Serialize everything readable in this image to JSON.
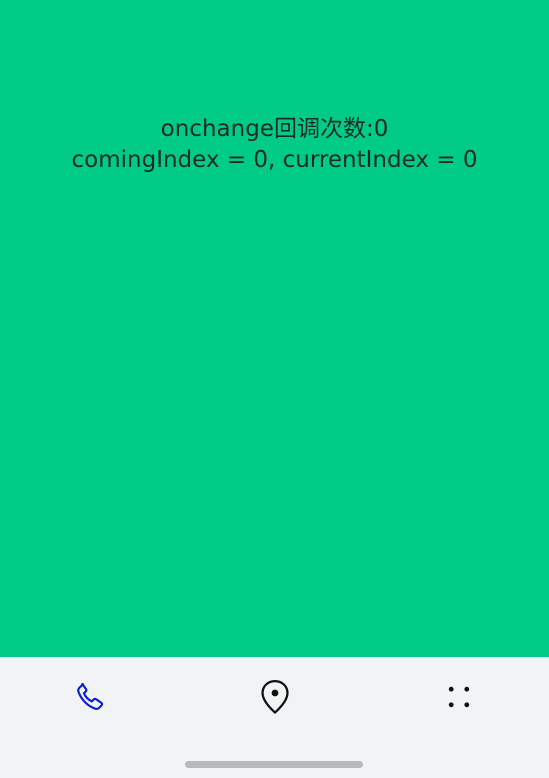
{
  "content": {
    "callback_count_line": "onchange回调次数:0",
    "index_line": "comingIndex = 0, currentIndex = 0",
    "background_color": "#00cc88",
    "text_color": "#1b2a25"
  },
  "tabbar": {
    "active_tab": "phone",
    "active_color": "#0a1ed8",
    "inactive_color": "#111111",
    "tabs": [
      {
        "id": "phone",
        "icon": "phone-icon"
      },
      {
        "id": "location",
        "icon": "location-pin-icon"
      },
      {
        "id": "more",
        "icon": "four-dots-icon"
      }
    ]
  }
}
